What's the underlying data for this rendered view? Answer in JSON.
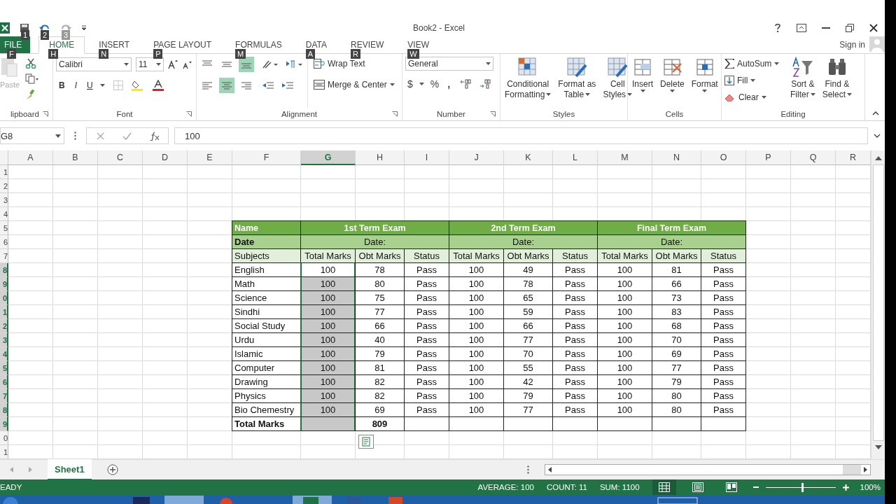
{
  "title_bar": {
    "title": "Book2 - Excel",
    "quick_access_keytips": [
      "1",
      "2",
      "3"
    ],
    "sign_in": "Sign in"
  },
  "tabs": [
    {
      "label": "FILE",
      "keytip": "F",
      "kind": "file",
      "selected": false
    },
    {
      "label": "HOME",
      "keytip": "H",
      "kind": "tab",
      "selected": true
    },
    {
      "label": "INSERT",
      "keytip": "N",
      "kind": "tab",
      "selected": false
    },
    {
      "label": "PAGE LAYOUT",
      "keytip": "P",
      "kind": "tab",
      "selected": false
    },
    {
      "label": "FORMULAS",
      "keytip": "M",
      "kind": "tab",
      "selected": false
    },
    {
      "label": "DATA",
      "keytip": "A",
      "kind": "tab",
      "selected": false
    },
    {
      "label": "REVIEW",
      "keytip": "R",
      "kind": "tab",
      "selected": false
    },
    {
      "label": "VIEW",
      "keytip": "W",
      "kind": "tab",
      "selected": false
    }
  ],
  "ribbon": {
    "groups": [
      {
        "kind": "clipboard",
        "label": "lipboard",
        "paste": "Paste"
      },
      {
        "kind": "font",
        "label": "Font",
        "font": "Calibri",
        "size": "11",
        "buttons": [
          "B",
          "I",
          "U"
        ]
      },
      {
        "kind": "alignment",
        "label": "Alignment",
        "wrap": "Wrap Text",
        "merge": "Merge & Center",
        "vertical_align": [
          {
            "selected": false
          },
          {
            "selected": false
          },
          {
            "selected": true
          }
        ],
        "horizontal_align": [
          {
            "selected": false
          },
          {
            "selected": true
          },
          {
            "selected": false
          }
        ]
      },
      {
        "kind": "number",
        "label": "Number",
        "format": "General",
        "buttons": [
          "$",
          "%",
          ","
        ]
      },
      {
        "kind": "styles",
        "label": "Styles",
        "buttons": [
          [
            "Conditional",
            "Formatting"
          ],
          [
            "Format as",
            "Table"
          ],
          [
            "Cell",
            "Styles"
          ]
        ]
      },
      {
        "kind": "cells",
        "label": "Cells",
        "buttons": [
          "Insert",
          "Delete",
          "Format"
        ]
      },
      {
        "kind": "editing",
        "label": "Editing",
        "small": [
          "AutoSum",
          "Fill",
          "Clear"
        ],
        "buttons": [
          [
            "Sort &",
            "Filter"
          ],
          [
            "Find &",
            "Select"
          ]
        ]
      }
    ]
  },
  "formula_bar": {
    "name_box": "G8",
    "value": "100"
  },
  "column_headers": [
    {
      "label": "A",
      "selected": false
    },
    {
      "label": "B",
      "selected": false
    },
    {
      "label": "C",
      "selected": false
    },
    {
      "label": "D",
      "selected": false
    },
    {
      "label": "E",
      "selected": false
    },
    {
      "label": "F",
      "selected": false
    },
    {
      "label": "G",
      "selected": true
    },
    {
      "label": "H",
      "selected": false
    },
    {
      "label": "I",
      "selected": false
    },
    {
      "label": "J",
      "selected": false
    },
    {
      "label": "K",
      "selected": false
    },
    {
      "label": "L",
      "selected": false
    },
    {
      "label": "M",
      "selected": false
    },
    {
      "label": "N",
      "selected": false
    },
    {
      "label": "O",
      "selected": false
    },
    {
      "label": "P",
      "selected": false
    },
    {
      "label": "Q",
      "selected": false
    },
    {
      "label": "R",
      "selected": false
    }
  ],
  "row_headers": [
    {
      "label": "1",
      "selected": false
    },
    {
      "label": "2",
      "selected": false
    },
    {
      "label": "3",
      "selected": false
    },
    {
      "label": "4",
      "selected": false
    },
    {
      "label": "5",
      "selected": false
    },
    {
      "label": "6",
      "selected": false
    },
    {
      "label": "7",
      "selected": false
    },
    {
      "label": "8",
      "selected": true
    },
    {
      "label": "9",
      "selected": true
    },
    {
      "label": "0",
      "selected": true
    },
    {
      "label": "1",
      "selected": true
    },
    {
      "label": "2",
      "selected": true
    },
    {
      "label": "3",
      "selected": true
    },
    {
      "label": "4",
      "selected": true
    },
    {
      "label": "5",
      "selected": true
    },
    {
      "label": "6",
      "selected": true
    },
    {
      "label": "7",
      "selected": true
    },
    {
      "label": "8",
      "selected": true
    },
    {
      "label": "9",
      "selected": true
    },
    {
      "label": "0",
      "selected": false
    },
    {
      "label": "1",
      "selected": false
    }
  ],
  "table": {
    "title_row": {
      "label": "Name",
      "exams": [
        "1st Term Exam",
        "2nd Term Exam",
        "Final Term Exam"
      ]
    },
    "date_row": {
      "label": "Date",
      "dates": [
        "Date:",
        "Date:",
        "Date:"
      ]
    },
    "column_row": {
      "label": "Subjects",
      "columns": [
        "Total Marks",
        "Obt Marks",
        "Status",
        "Total Marks",
        "Obt Marks",
        "Status",
        "Total Marks",
        "Obt Marks",
        "Status"
      ]
    },
    "rows": [
      {
        "subject": "English",
        "cells": [
          "100",
          "78",
          "Pass",
          "100",
          "49",
          "Pass",
          "100",
          "81",
          "Pass"
        ]
      },
      {
        "subject": "Math",
        "cells": [
          "100",
          "80",
          "Pass",
          "100",
          "78",
          "Pass",
          "100",
          "66",
          "Pass"
        ]
      },
      {
        "subject": "Science",
        "cells": [
          "100",
          "75",
          "Pass",
          "100",
          "65",
          "Pass",
          "100",
          "73",
          "Pass"
        ]
      },
      {
        "subject": "Sindhi",
        "cells": [
          "100",
          "77",
          "Pass",
          "100",
          "59",
          "Pass",
          "100",
          "83",
          "Pass"
        ]
      },
      {
        "subject": "Social Study",
        "cells": [
          "100",
          "66",
          "Pass",
          "100",
          "66",
          "Pass",
          "100",
          "68",
          "Pass"
        ]
      },
      {
        "subject": "Urdu",
        "cells": [
          "100",
          "40",
          "Pass",
          "100",
          "77",
          "Pass",
          "100",
          "70",
          "Pass"
        ]
      },
      {
        "subject": "Islamic",
        "cells": [
          "100",
          "79",
          "Pass",
          "100",
          "70",
          "Pass",
          "100",
          "69",
          "Pass"
        ]
      },
      {
        "subject": "Computer",
        "cells": [
          "100",
          "81",
          "Pass",
          "100",
          "55",
          "Pass",
          "100",
          "77",
          "Pass"
        ]
      },
      {
        "subject": "Drawing",
        "cells": [
          "100",
          "82",
          "Pass",
          "100",
          "42",
          "Pass",
          "100",
          "79",
          "Pass"
        ]
      },
      {
        "subject": "Physics",
        "cells": [
          "100",
          "82",
          "Pass",
          "100",
          "79",
          "Pass",
          "100",
          "80",
          "Pass"
        ]
      },
      {
        "subject": "Bio Chemestry",
        "cells": [
          "100",
          "69",
          "Pass",
          "100",
          "77",
          "Pass",
          "100",
          "80",
          "Pass"
        ]
      }
    ],
    "total_row": {
      "label": "Total Marks",
      "obt_total": "809"
    }
  },
  "sheet_tabs": [
    {
      "label": "Sheet1",
      "selected": true
    }
  ],
  "status_bar": {
    "mode": "EADY",
    "stats": [
      "AVERAGE: 100",
      "COUNT: 11",
      "SUM: 1100"
    ],
    "views": [
      {
        "selected": true
      },
      {
        "selected": false
      },
      {
        "selected": false
      }
    ],
    "zoom": {
      "level": 0.52,
      "reading": "100%"
    }
  }
}
